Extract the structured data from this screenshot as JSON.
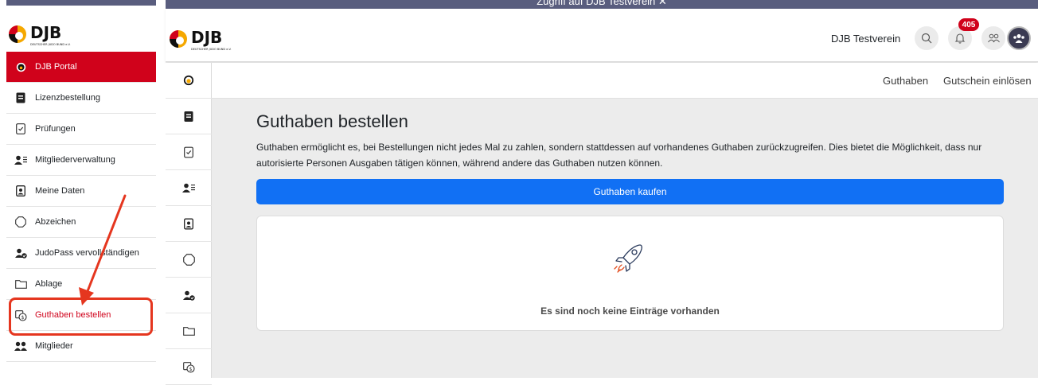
{
  "banner": {
    "text": "Zugriff auf DJB Testverein ✕"
  },
  "logo": {
    "text": "DJB",
    "subtext": "DEUTSCHER JUDO BUND e.V."
  },
  "header": {
    "club_name": "DJB Testverein",
    "notification_count": "405"
  },
  "menu": {
    "items": [
      {
        "label": "DJB Portal",
        "icon": "djb-portal-icon"
      },
      {
        "label": "Lizenzbestellung",
        "icon": "license-icon"
      },
      {
        "label": "Prüfungen",
        "icon": "exam-checklist-icon"
      },
      {
        "label": "Mitgliederverwaltung",
        "icon": "member-management-icon"
      },
      {
        "label": "Meine Daten",
        "icon": "profile-card-icon"
      },
      {
        "label": "Abzeichen",
        "icon": "badge-octagon-icon"
      },
      {
        "label": "JudoPass vervollständigen",
        "icon": "user-check-icon"
      },
      {
        "label": "Ablage",
        "icon": "folder-icon"
      },
      {
        "label": "Guthaben bestellen",
        "icon": "credit-order-icon"
      },
      {
        "label": "Mitglieder",
        "icon": "members-icon"
      }
    ]
  },
  "subnav": {
    "link1": "Guthaben",
    "link2": "Gutschein einlösen"
  },
  "main": {
    "title": "Guthaben bestellen",
    "description": "Guthaben ermöglicht es, bei Bestellungen nicht jedes Mal zu zahlen, sondern stattdessen auf vorhandenes Guthaben zurückzugreifen. Dies bietet die Möglichkeit, dass nur autorisierte Personen Ausgaben tätigen können, während andere das Guthaben nutzen können.",
    "buy_button": "Guthaben kaufen",
    "empty_text": "Es sind noch keine Einträge vorhanden"
  },
  "colors": {
    "brand_red": "#d0021b",
    "primary_blue": "#1170f4",
    "banner": "#595d7e",
    "annotation": "#e5361f"
  }
}
